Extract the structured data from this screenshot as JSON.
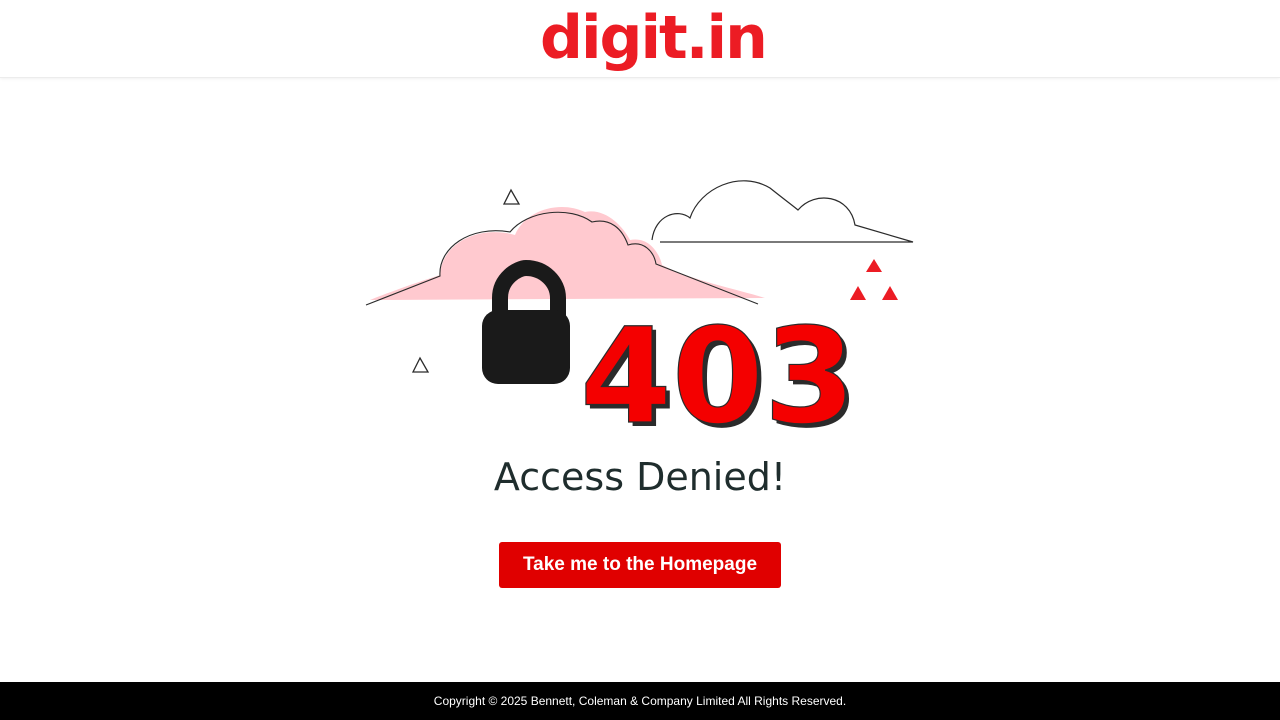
{
  "header": {
    "logo_text": "digit.in"
  },
  "main": {
    "error_code": "403",
    "title": "Access Denied!",
    "home_button_label": "Take me to the Homepage"
  },
  "footer": {
    "copyright": "Copyright © 2025 Bennett, Coleman & Company Limited All Rights Reserved."
  },
  "icons": {
    "lock": "lock-icon",
    "clouds": "cloud-icon",
    "triangles": "triangle-icon"
  },
  "colors": {
    "brand_red": "#ec1c24",
    "button_red": "#e00000",
    "cloud_pink": "#ffc9cf",
    "footer_bg": "#000000",
    "title_text": "#1f2d2d",
    "lock_black": "#1a1a1a"
  }
}
